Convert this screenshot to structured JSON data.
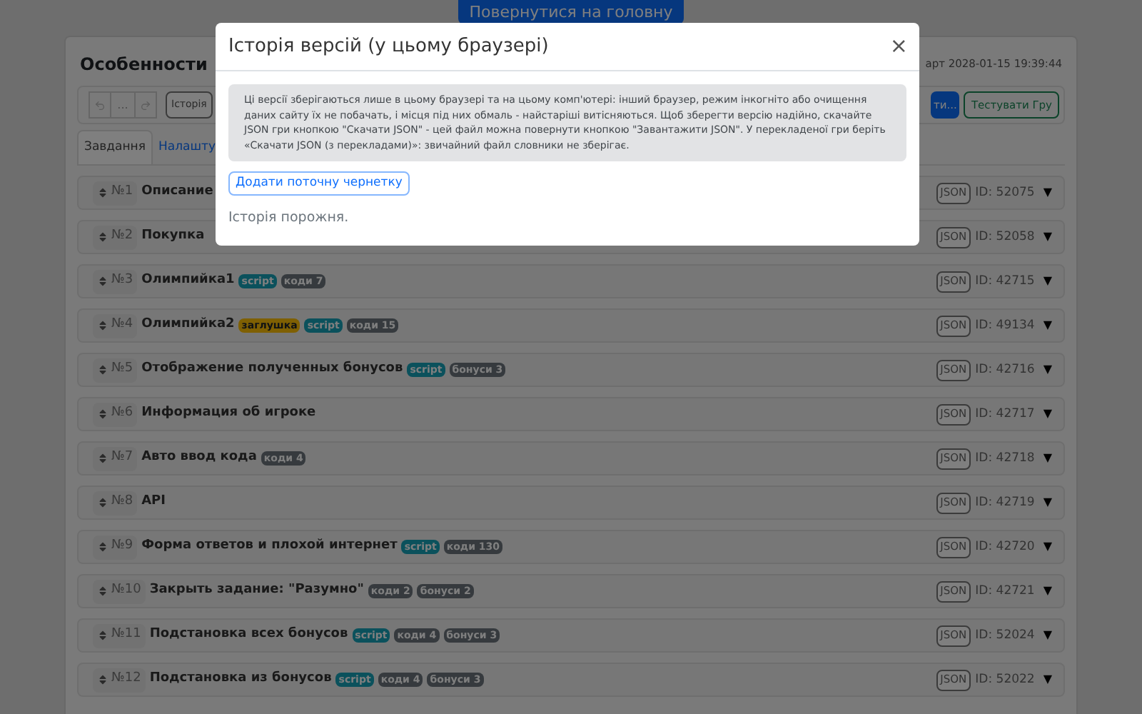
{
  "home_button": "Повернутися на головну",
  "page": {
    "title": "Особенности",
    "started": "арт 2028-01-15 19:39:44",
    "toolbar": {
      "undo_disabled": true,
      "redo_disabled": true,
      "more": "...",
      "history": "Історія",
      "publish": "ти...",
      "test": "Тестувати Гру"
    },
    "tabs": [
      {
        "label": "Завдання",
        "selected": true
      },
      {
        "label": "Налашту",
        "selected": false
      }
    ],
    "tasks": [
      {
        "number": "№1",
        "title": "Описание",
        "json": "JSON",
        "id": "ID: 52075",
        "toggle": "▼"
      },
      {
        "number": "№2",
        "title": "Покупка",
        "json": "JSON",
        "id": "ID: 52058",
        "toggle": "▼"
      },
      {
        "number": "№3",
        "title": "Олимпийка1",
        "tags": [
          {
            "kind": "script",
            "text": "script"
          },
          {
            "kind": "count",
            "text": "коди 7"
          }
        ],
        "json": "JSON",
        "id": "ID: 42715",
        "toggle": "▼"
      },
      {
        "number": "№4",
        "title": "Олимпийка2",
        "tags": [
          {
            "kind": "stub",
            "text": "заглушка"
          },
          {
            "kind": "script",
            "text": "script"
          },
          {
            "kind": "count",
            "text": "коди 15"
          }
        ],
        "json": "JSON",
        "id": "ID: 49134",
        "toggle": "▼"
      },
      {
        "number": "№5",
        "title": "Отображение полученных бонусов",
        "tags": [
          {
            "kind": "script",
            "text": "script"
          },
          {
            "kind": "count",
            "text": "бонуси 3"
          }
        ],
        "json": "JSON",
        "id": "ID: 42716",
        "toggle": "▼"
      },
      {
        "number": "№6",
        "title": "Информация об игроке",
        "json": "JSON",
        "id": "ID: 42717",
        "toggle": "▼"
      },
      {
        "number": "№7",
        "title": "Авто ввод кода",
        "tags": [
          {
            "kind": "count",
            "text": "коди 4"
          }
        ],
        "json": "JSON",
        "id": "ID: 42718",
        "toggle": "▼"
      },
      {
        "number": "№8",
        "title": "API",
        "json": "JSON",
        "id": "ID: 42719",
        "toggle": "▼"
      },
      {
        "number": "№9",
        "title": "Форма ответов и плохой интернет",
        "tags": [
          {
            "kind": "script",
            "text": "script"
          },
          {
            "kind": "count",
            "text": "коди 130"
          }
        ],
        "json": "JSON",
        "id": "ID: 42720",
        "toggle": "▼"
      },
      {
        "number": "№10",
        "title": "Закрыть задание: \"Разумно\"",
        "tags": [
          {
            "kind": "count",
            "text": "коди 2"
          },
          {
            "kind": "count",
            "text": "бонуси 2"
          }
        ],
        "json": "JSON",
        "id": "ID: 42721",
        "toggle": "▼"
      },
      {
        "number": "№11",
        "title": "Подстановка всех бонусов",
        "tags": [
          {
            "kind": "script",
            "text": "script"
          },
          {
            "kind": "count",
            "text": "коди 4"
          },
          {
            "kind": "count",
            "text": "бонуси 3"
          }
        ],
        "json": "JSON",
        "id": "ID: 52024",
        "toggle": "▼"
      },
      {
        "number": "№12",
        "title": "Подстановка из бонусов",
        "tags": [
          {
            "kind": "script",
            "text": "script"
          },
          {
            "kind": "count",
            "text": "коди 4"
          },
          {
            "kind": "count",
            "text": "бонуси 3"
          }
        ],
        "json": "JSON",
        "id": "ID: 52022",
        "toggle": "▼"
      }
    ]
  },
  "modal": {
    "title": "Історія версій (у цьому браузері)",
    "close": "×",
    "notice": "Ці версії зберігаються лише в цьому браузері та на цьому комп'ютері: інший браузер, режим інкогніто або очищення даних сайту їх не побачать, і місця під них обмаль - найстаріші витісняються. Щоб зберегти версію надійно, скачайте JSON гри кнопкою \"Скачати JSON\" - цей файл можна повернути кнопкою \"Завантажити JSON\". У перекладеної гри беріть «Скачати JSON (з перекладами)»: звичайний файл словники не зберігає.",
    "add_button": "Додати поточну чернетку",
    "empty": "Історія порожня."
  }
}
